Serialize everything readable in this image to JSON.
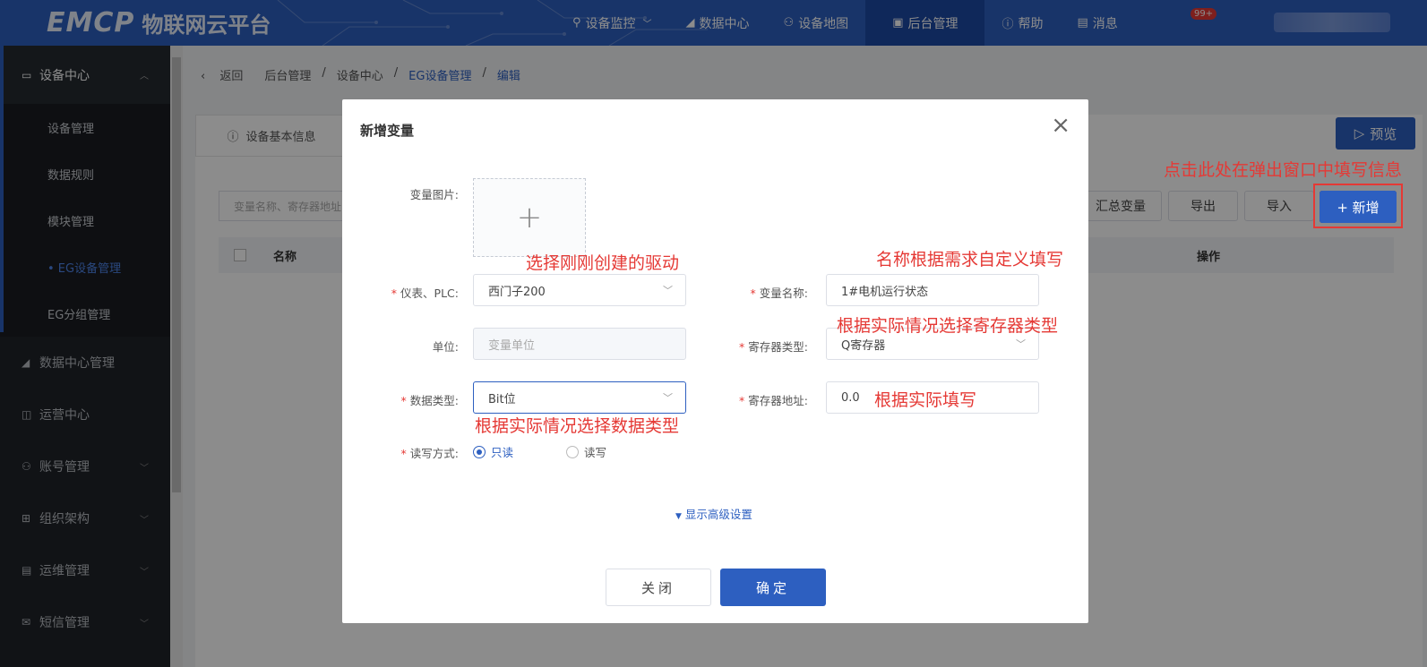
{
  "header": {
    "logo_mark": "EMCP",
    "logo_text": "物联网云平台",
    "nav": [
      {
        "label": "设备监控",
        "icon": "location-icon",
        "dropdown": true
      },
      {
        "label": "数据中心",
        "icon": "chart-icon"
      },
      {
        "label": "设备地图",
        "icon": "user-icon"
      },
      {
        "label": "后台管理",
        "icon": "monitor-icon",
        "active": true
      },
      {
        "label": "帮助",
        "icon": "help-icon"
      },
      {
        "label": "消息",
        "icon": "message-icon"
      }
    ],
    "message_badge": "99+"
  },
  "sidebar": {
    "group": {
      "label": "设备中心"
    },
    "sub_items": [
      {
        "label": "设备管理"
      },
      {
        "label": "数据规则"
      },
      {
        "label": "模块管理"
      },
      {
        "label": "• EG设备管理",
        "active": true
      },
      {
        "label": "EG分组管理"
      }
    ],
    "items": [
      {
        "label": "数据中心管理"
      },
      {
        "label": "运营中心"
      },
      {
        "label": "账号管理"
      },
      {
        "label": "组织架构"
      },
      {
        "label": "运维管理"
      },
      {
        "label": "短信管理"
      }
    ]
  },
  "breadcrumb": {
    "back": "返回",
    "items": [
      "后台管理",
      "/",
      "设备中心",
      "/",
      "EG设备管理",
      "/",
      "编辑"
    ]
  },
  "page": {
    "tab_label": "设备基本信息",
    "preview_label": "预览",
    "search_placeholder": "变量名称、寄存器地址",
    "summary_btn": "汇总变量",
    "export_btn": "导出",
    "import_btn": "导入",
    "add_btn": "+ 新增",
    "table_col_name": "名称",
    "table_col_action": "操作"
  },
  "modal": {
    "title": "新增变量",
    "close_icon": "×",
    "image_label": "变量图片:",
    "plc_label": "仪表、PLC:",
    "plc_value": "西门子200",
    "var_name_label": "变量名称:",
    "var_name_value": "1#电机运行状态",
    "unit_label": "单位:",
    "unit_placeholder": "变量单位",
    "reg_type_label": "寄存器类型:",
    "reg_type_value": "Q寄存器",
    "data_type_label": "数据类型:",
    "data_type_value": "Bit位",
    "reg_addr_label": "寄存器地址:",
    "reg_addr_value": "0.0",
    "rw_label": "读写方式:",
    "rw_options": [
      "只读",
      "读写"
    ],
    "rw_selected": "只读",
    "advanced": "显示高级设置",
    "cancel_btn": "关闭",
    "ok_btn": "确定"
  },
  "annotations": {
    "add_hint": "点击此处在弹出窗口中填写信息",
    "driver_hint": "选择刚刚创建的驱动",
    "name_hint": "名称根据需求自定义填写",
    "reg_type_hint": "根据实际情况选择寄存器类型",
    "data_type_hint": "根据实际情况选择数据类型",
    "reg_addr_hint": "根据实际填写"
  },
  "colors": {
    "primary": "#2d5fc0",
    "annotation": "#e53935",
    "sidebar": "#1f2329"
  }
}
